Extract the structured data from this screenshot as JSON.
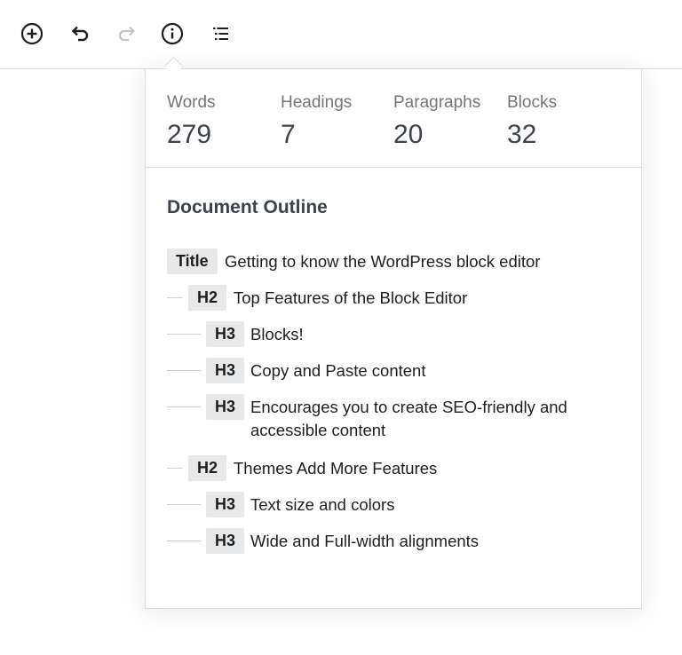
{
  "toolbar": {
    "buttons": [
      {
        "name": "add-block-button",
        "icon": "plus-circle-icon",
        "enabled": true
      },
      {
        "name": "undo-button",
        "icon": "undo-icon",
        "enabled": true
      },
      {
        "name": "redo-button",
        "icon": "redo-icon",
        "enabled": false
      },
      {
        "name": "details-button",
        "icon": "info-icon",
        "enabled": true
      },
      {
        "name": "outline-button",
        "icon": "list-view-icon",
        "enabled": true
      }
    ]
  },
  "stats": {
    "words_label": "Words",
    "words_value": "279",
    "headings_label": "Headings",
    "headings_value": "7",
    "paragraphs_label": "Paragraphs",
    "paragraphs_value": "20",
    "blocks_label": "Blocks",
    "blocks_value": "32"
  },
  "outline": {
    "title": "Document Outline",
    "items": [
      {
        "level": "Title",
        "text": "Getting to know the WordPress block editor"
      },
      {
        "level": "H2",
        "text": "Top Features of the Block Editor"
      },
      {
        "level": "H3",
        "text": "Blocks!"
      },
      {
        "level": "H3",
        "text": "Copy and Paste content"
      },
      {
        "level": "H3",
        "text": "Encourages you to create SEO-friendly and accessible content"
      },
      {
        "level": "H2",
        "text": "Themes Add More Features"
      },
      {
        "level": "H3",
        "text": "Text size and colors"
      },
      {
        "level": "H3",
        "text": "Wide and Full-width alignments"
      }
    ]
  },
  "colors": {
    "text": "#1e1e1e",
    "muted": "#757575",
    "badge_bg": "#e6e8ea",
    "border": "#dcdcde",
    "disabled_icon": "#c3c4c7"
  }
}
